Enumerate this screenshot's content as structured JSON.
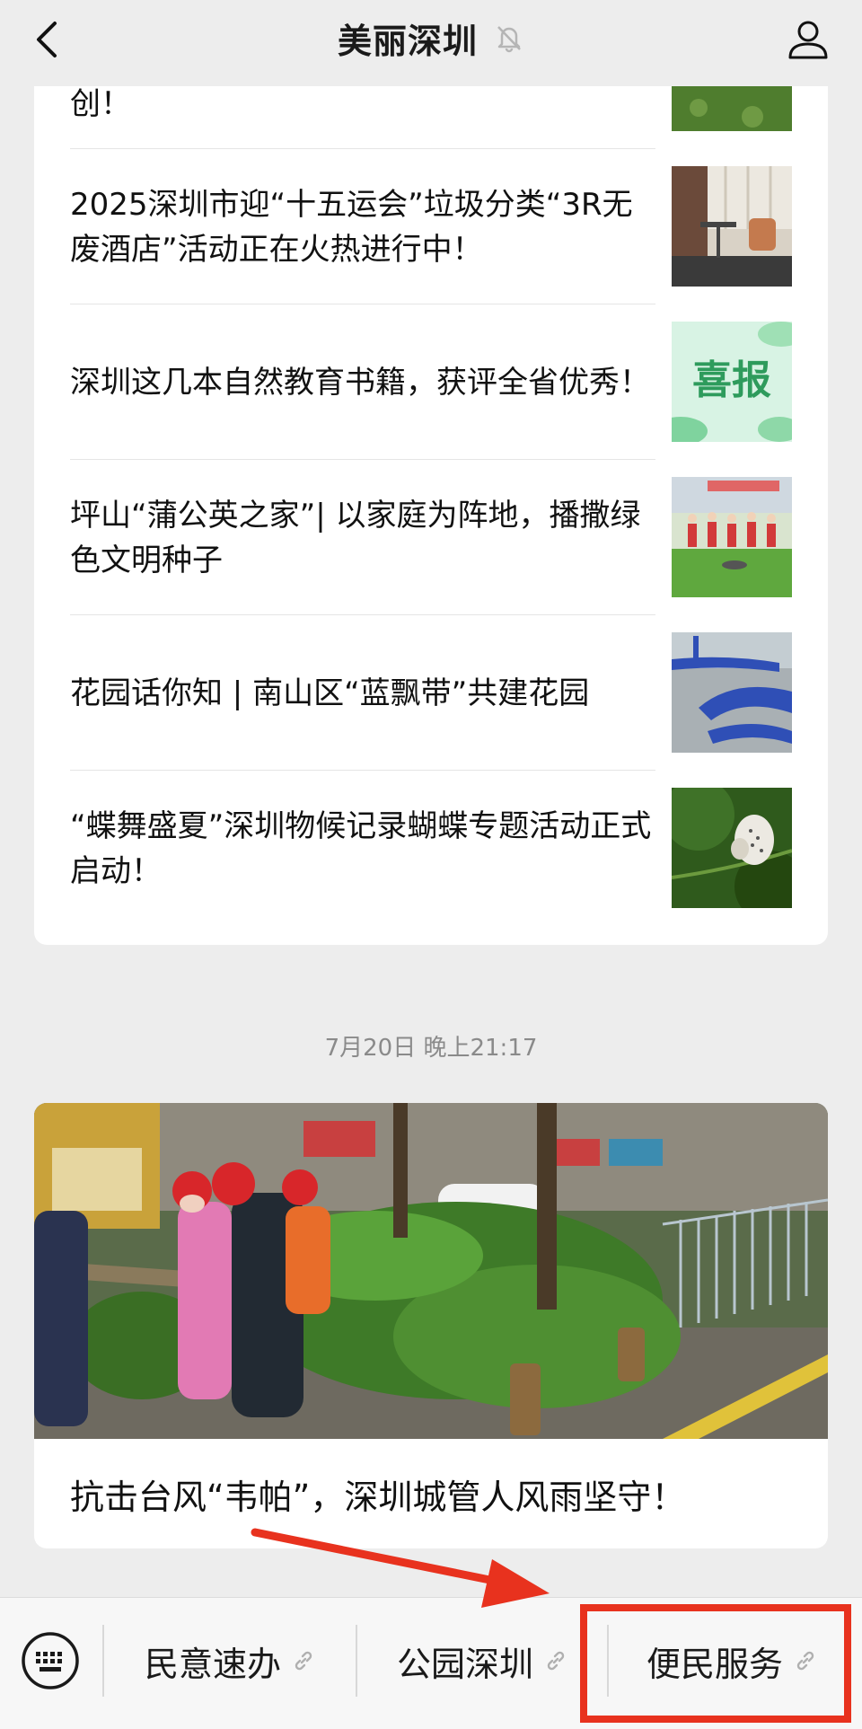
{
  "header": {
    "title": "美丽深圳",
    "back_icon": "chevron-left-icon",
    "mute_icon": "bell-muted-icon",
    "profile_icon": "user-icon"
  },
  "articles": {
    "partial_first": "创！",
    "items": [
      {
        "title": "2025深圳市迎“十五运会”垃圾分类“3R无废酒店”活动正在火热进行中！"
      },
      {
        "title": "深圳这几本自然教育书籍，获评全省优秀！",
        "thumb_text": "喜报"
      },
      {
        "title": "坪山“蒲公英之家”| 以家庭为阵地，播撒绿色文明种子"
      },
      {
        "title": "花园话你知 | 南山区“蓝飘带”共建花园"
      },
      {
        "title": "“蝶舞盛夏”深圳物候记录蝴蝶专题活动正式启动！"
      }
    ]
  },
  "timestamp": "7月20日 晚上21:17",
  "featured": {
    "title": "抗击台风“韦帕”，深圳城管人风雨坚守！"
  },
  "bottom_menu": {
    "keyboard_icon": "keyboard-icon",
    "items": [
      {
        "label": "民意速办"
      },
      {
        "label": "公园深圳"
      },
      {
        "label": "便民服务"
      }
    ]
  },
  "colors": {
    "background": "#ededed",
    "card": "#ffffff",
    "highlight": "#e8321e"
  }
}
